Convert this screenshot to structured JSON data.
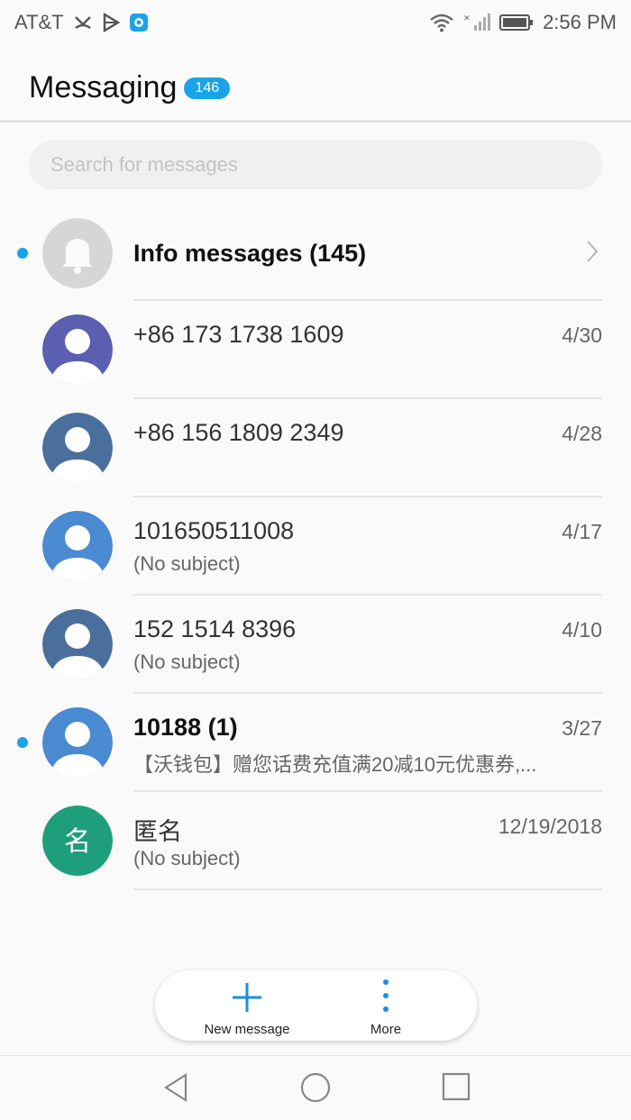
{
  "status_bar": {
    "carrier": "AT&T",
    "time": "2:56 PM"
  },
  "header": {
    "title": "Messaging",
    "badge_count": "146"
  },
  "search": {
    "placeholder": "Search for messages"
  },
  "conversations": [
    {
      "name": "Info messages (145)",
      "date": "",
      "preview": "",
      "unread": true,
      "avatar": "bell-icon"
    },
    {
      "name": "+86 173 1738 1609",
      "date": "4/30",
      "preview": "",
      "unread": false,
      "avatar": "person-icon"
    },
    {
      "name": "+86 156 1809 2349",
      "date": "4/28",
      "preview": "",
      "unread": false,
      "avatar": "person-icon"
    },
    {
      "name": "101650511008",
      "date": "4/17",
      "preview": "(No subject)",
      "unread": false,
      "avatar": "person-icon"
    },
    {
      "name": "152 1514 8396",
      "date": "4/10",
      "preview": "(No subject)",
      "unread": false,
      "avatar": "person-icon"
    },
    {
      "name": "10188 (1)",
      "date": "3/27",
      "preview": "【沃钱包】赠您话费充值满20减10元优惠券,...",
      "unread": true,
      "avatar": "person-icon"
    },
    {
      "name": "匿名",
      "date": "12/19/2018",
      "preview": "(No subject)",
      "unread": false,
      "avatar": "名"
    }
  ],
  "actions": {
    "new_message_label": "New message",
    "more_label": "More"
  },
  "colors": {
    "accent": "#1aa3e8",
    "avatar_purple": "#5a5fb0",
    "avatar_steel": "#4b6f9c",
    "avatar_blue": "#4a8ad0",
    "avatar_green": "#1f9e7c"
  }
}
